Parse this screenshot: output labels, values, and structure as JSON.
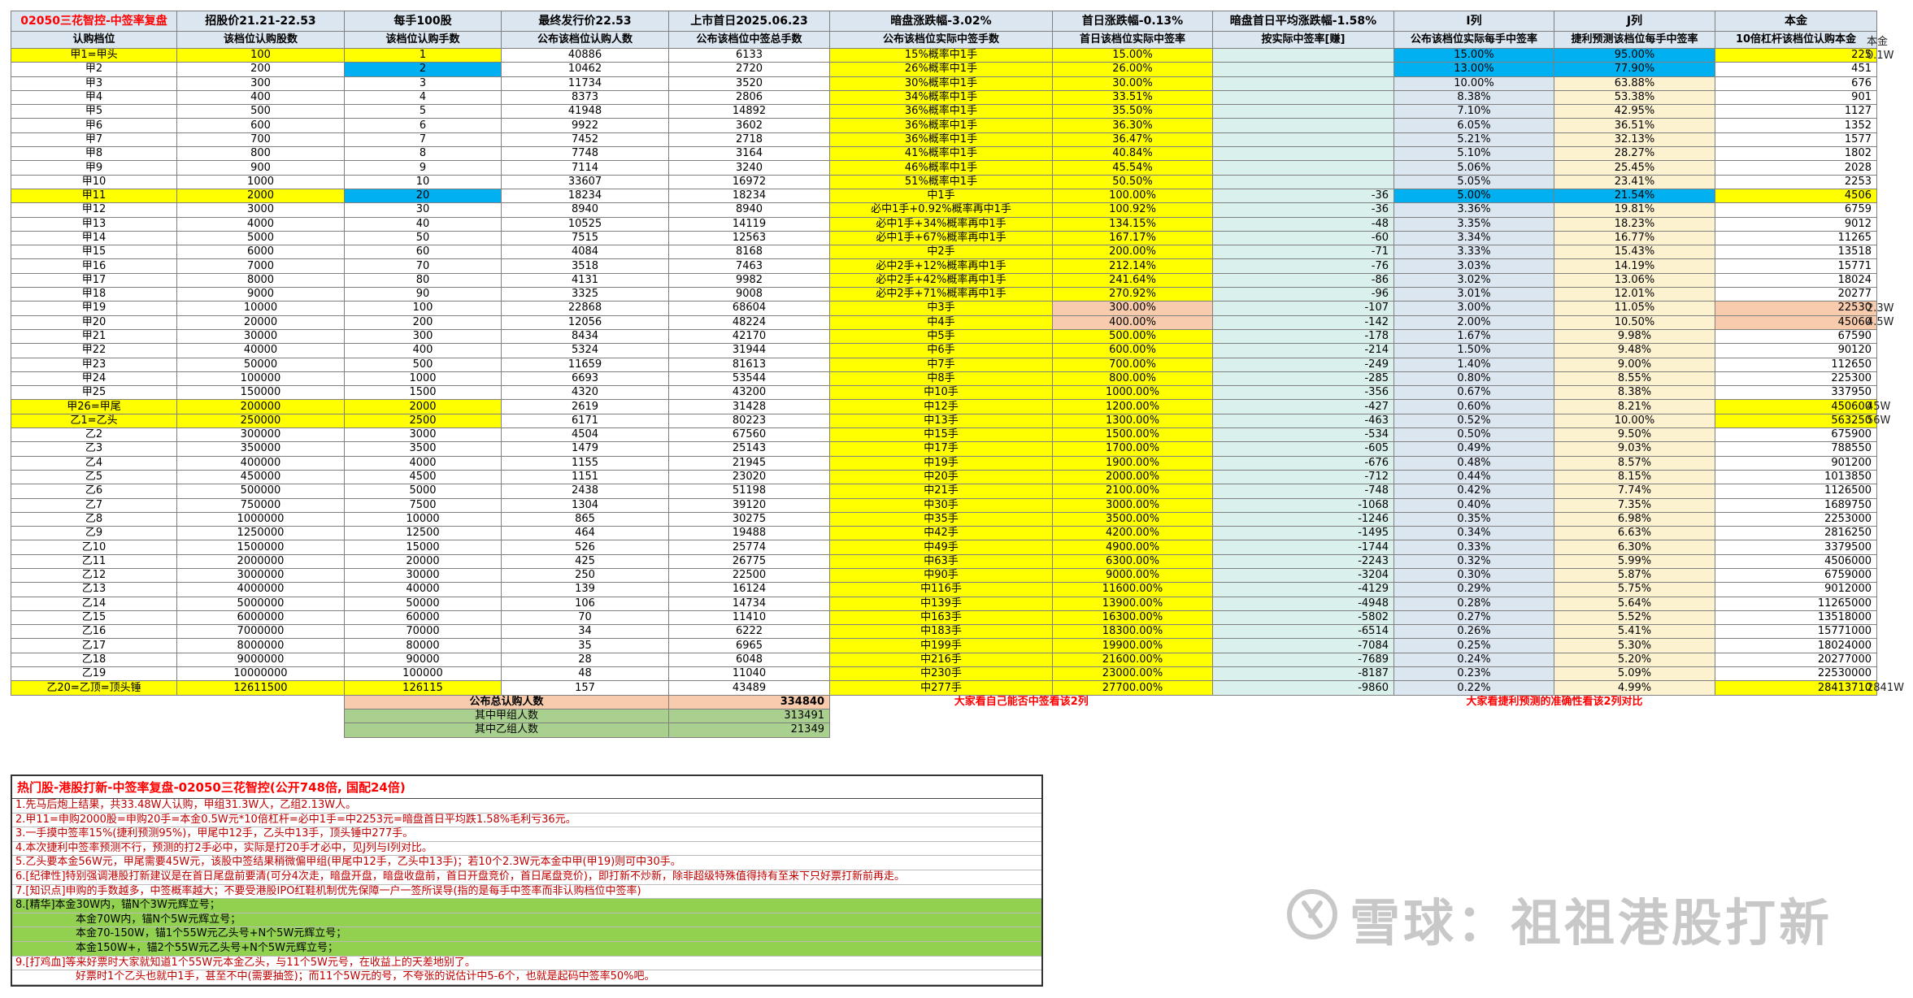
{
  "headers": {
    "title": "02050三花智控-中签率复盘",
    "price_range": "招股价21.21-22.53",
    "lot": "每手100股",
    "final_price": "最终发行价22.53",
    "listing": "上市首日2025.06.23",
    "grey": "暗盘涨跌幅-3.02%",
    "first_day": "首日涨跌幅-0.13%",
    "grey_avg": "暗盘首日平均涨跌幅-1.58%",
    "col_i": "I列",
    "col_j": "J列",
    "principal": "本金"
  },
  "subheaders": {
    "level": "认购档位",
    "shares": "该档位认购股数",
    "lots": "该档位认购手数",
    "people": "公布该档位认购人数",
    "total_lots": "公布该档位中签总手数",
    "actual": "公布该档位实际中签手数",
    "rate": "首日该档位实际中签率",
    "profit": "按实际中签率[赚]",
    "i_rate": "公布该档位实际每手中签率",
    "j_rate": "捷利预测该档位每手中签率",
    "principal": "10倍杠杆该档位认购本金"
  },
  "rows": [
    {
      "level": "甲1=甲头",
      "shares": "100",
      "lots": "1",
      "people": "40886",
      "total": "6133",
      "actual": "15%概率中1手",
      "rate": "15.00%",
      "profit": "",
      "i": "15.00%",
      "j": "95.00%",
      "principal": "225",
      "side": "0.1W",
      "hl": true
    },
    {
      "level": "甲2",
      "shares": "200",
      "lots": "2",
      "people": "10462",
      "total": "2720",
      "actual": "26%概率中1手",
      "rate": "26.00%",
      "profit": "",
      "i": "13.00%",
      "j": "77.90%",
      "principal": "451",
      "side": "",
      "bluelots": true
    },
    {
      "level": "甲3",
      "shares": "300",
      "lots": "3",
      "people": "11734",
      "total": "3520",
      "actual": "30%概率中1手",
      "rate": "30.00%",
      "profit": "",
      "i": "10.00%",
      "j": "63.88%",
      "principal": "676",
      "side": ""
    },
    {
      "level": "甲4",
      "shares": "400",
      "lots": "4",
      "people": "8373",
      "total": "2806",
      "actual": "34%概率中1手",
      "rate": "33.51%",
      "profit": "",
      "i": "8.38%",
      "j": "53.38%",
      "principal": "901",
      "side": ""
    },
    {
      "level": "甲5",
      "shares": "500",
      "lots": "5",
      "people": "41948",
      "total": "14892",
      "actual": "36%概率中1手",
      "rate": "35.50%",
      "profit": "",
      "i": "7.10%",
      "j": "42.95%",
      "principal": "1127",
      "side": ""
    },
    {
      "level": "甲6",
      "shares": "600",
      "lots": "6",
      "people": "9922",
      "total": "3602",
      "actual": "36%概率中1手",
      "rate": "36.30%",
      "profit": "",
      "i": "6.05%",
      "j": "36.51%",
      "principal": "1352",
      "side": ""
    },
    {
      "level": "甲7",
      "shares": "700",
      "lots": "7",
      "people": "7452",
      "total": "2718",
      "actual": "36%概率中1手",
      "rate": "36.47%",
      "profit": "",
      "i": "5.21%",
      "j": "32.13%",
      "principal": "1577",
      "side": ""
    },
    {
      "level": "甲8",
      "shares": "800",
      "lots": "8",
      "people": "7748",
      "total": "3164",
      "actual": "41%概率中1手",
      "rate": "40.84%",
      "profit": "",
      "i": "5.10%",
      "j": "28.27%",
      "principal": "1802",
      "side": ""
    },
    {
      "level": "甲9",
      "shares": "900",
      "lots": "9",
      "people": "7114",
      "total": "3240",
      "actual": "46%概率中1手",
      "rate": "45.54%",
      "profit": "",
      "i": "5.06%",
      "j": "25.45%",
      "principal": "2028",
      "side": ""
    },
    {
      "level": "甲10",
      "shares": "1000",
      "lots": "10",
      "people": "33607",
      "total": "16972",
      "actual": "51%概率中1手",
      "rate": "50.50%",
      "profit": "",
      "i": "5.05%",
      "j": "23.41%",
      "principal": "2253",
      "side": ""
    },
    {
      "level": "甲11",
      "shares": "2000",
      "lots": "20",
      "people": "18234",
      "total": "18234",
      "actual": "中1手",
      "rate": "100.00%",
      "profit": "-36",
      "i": "5.00%",
      "j": "21.54%",
      "principal": "4506",
      "side": "",
      "hl": true,
      "bluelots": true
    },
    {
      "level": "甲12",
      "shares": "3000",
      "lots": "30",
      "people": "8940",
      "total": "8940",
      "actual": "必中1手+0.92%概率再中1手",
      "rate": "100.92%",
      "profit": "-36",
      "i": "3.36%",
      "j": "19.81%",
      "principal": "6759",
      "side": ""
    },
    {
      "level": "甲13",
      "shares": "4000",
      "lots": "40",
      "people": "10525",
      "total": "14119",
      "actual": "必中1手+34%概率再中1手",
      "rate": "134.15%",
      "profit": "-48",
      "i": "3.35%",
      "j": "18.23%",
      "principal": "9012",
      "side": ""
    },
    {
      "level": "甲14",
      "shares": "5000",
      "lots": "50",
      "people": "7515",
      "total": "12563",
      "actual": "必中1手+67%概率再中1手",
      "rate": "167.17%",
      "profit": "-60",
      "i": "3.34%",
      "j": "16.77%",
      "principal": "11265",
      "side": ""
    },
    {
      "level": "甲15",
      "shares": "6000",
      "lots": "60",
      "people": "4084",
      "total": "8168",
      "actual": "中2手",
      "rate": "200.00%",
      "profit": "-71",
      "i": "3.33%",
      "j": "15.43%",
      "principal": "13518",
      "side": ""
    },
    {
      "level": "甲16",
      "shares": "7000",
      "lots": "70",
      "people": "3518",
      "total": "7463",
      "actual": "必中2手+12%概率再中1手",
      "rate": "212.14%",
      "profit": "-76",
      "i": "3.03%",
      "j": "14.19%",
      "principal": "15771",
      "side": ""
    },
    {
      "level": "甲17",
      "shares": "8000",
      "lots": "80",
      "people": "4131",
      "total": "9982",
      "actual": "必中2手+42%概率再中1手",
      "rate": "241.64%",
      "profit": "-86",
      "i": "3.02%",
      "j": "13.06%",
      "principal": "18024",
      "side": ""
    },
    {
      "level": "甲18",
      "shares": "9000",
      "lots": "90",
      "people": "3325",
      "total": "9008",
      "actual": "必中2手+71%概率再中1手",
      "rate": "270.92%",
      "profit": "-96",
      "i": "3.01%",
      "j": "12.01%",
      "principal": "20277",
      "side": ""
    },
    {
      "level": "甲19",
      "shares": "10000",
      "lots": "100",
      "people": "22868",
      "total": "68604",
      "actual": "中3手",
      "rate": "300.00%",
      "profit": "-107",
      "i": "3.00%",
      "j": "11.05%",
      "principal": "22530",
      "side": "2.3W",
      "peach": true
    },
    {
      "level": "甲20",
      "shares": "20000",
      "lots": "200",
      "people": "12056",
      "total": "48224",
      "actual": "中4手",
      "rate": "400.00%",
      "profit": "-142",
      "i": "2.00%",
      "j": "10.50%",
      "principal": "45060",
      "side": "4.5W",
      "peach": true
    },
    {
      "level": "甲21",
      "shares": "30000",
      "lots": "300",
      "people": "8434",
      "total": "42170",
      "actual": "中5手",
      "rate": "500.00%",
      "profit": "-178",
      "i": "1.67%",
      "j": "9.98%",
      "principal": "67590",
      "side": ""
    },
    {
      "level": "甲22",
      "shares": "40000",
      "lots": "400",
      "people": "5324",
      "total": "31944",
      "actual": "中6手",
      "rate": "600.00%",
      "profit": "-214",
      "i": "1.50%",
      "j": "9.48%",
      "principal": "90120",
      "side": ""
    },
    {
      "level": "甲23",
      "shares": "50000",
      "lots": "500",
      "people": "11659",
      "total": "81613",
      "actual": "中7手",
      "rate": "700.00%",
      "profit": "-249",
      "i": "1.40%",
      "j": "9.00%",
      "principal": "112650",
      "side": ""
    },
    {
      "level": "甲24",
      "shares": "100000",
      "lots": "1000",
      "people": "6693",
      "total": "53544",
      "actual": "中8手",
      "rate": "800.00%",
      "profit": "-285",
      "i": "0.80%",
      "j": "8.55%",
      "principal": "225300",
      "side": ""
    },
    {
      "level": "甲25",
      "shares": "150000",
      "lots": "1500",
      "people": "4320",
      "total": "43200",
      "actual": "中10手",
      "rate": "1000.00%",
      "profit": "-356",
      "i": "0.67%",
      "j": "8.38%",
      "principal": "337950",
      "side": ""
    },
    {
      "level": "甲26=甲尾",
      "shares": "200000",
      "lots": "2000",
      "people": "2619",
      "total": "31428",
      "actual": "中12手",
      "rate": "1200.00%",
      "profit": "-427",
      "i": "0.60%",
      "j": "8.21%",
      "principal": "450600",
      "side": "45W",
      "hl": true
    },
    {
      "level": "乙1=乙头",
      "shares": "250000",
      "lots": "2500",
      "people": "6171",
      "total": "80223",
      "actual": "中13手",
      "rate": "1300.00%",
      "profit": "-463",
      "i": "0.52%",
      "j": "10.00%",
      "principal": "563250",
      "side": "56W",
      "hl": true
    },
    {
      "level": "乙2",
      "shares": "300000",
      "lots": "3000",
      "people": "4504",
      "total": "67560",
      "actual": "中15手",
      "rate": "1500.00%",
      "profit": "-534",
      "i": "0.50%",
      "j": "9.50%",
      "principal": "675900",
      "side": ""
    },
    {
      "level": "乙3",
      "shares": "350000",
      "lots": "3500",
      "people": "1479",
      "total": "25143",
      "actual": "中17手",
      "rate": "1700.00%",
      "profit": "-605",
      "i": "0.49%",
      "j": "9.03%",
      "principal": "788550",
      "side": ""
    },
    {
      "level": "乙4",
      "shares": "400000",
      "lots": "4000",
      "people": "1155",
      "total": "21945",
      "actual": "中19手",
      "rate": "1900.00%",
      "profit": "-676",
      "i": "0.48%",
      "j": "8.57%",
      "principal": "901200",
      "side": ""
    },
    {
      "level": "乙5",
      "shares": "450000",
      "lots": "4500",
      "people": "1151",
      "total": "23020",
      "actual": "中20手",
      "rate": "2000.00%",
      "profit": "-712",
      "i": "0.44%",
      "j": "8.15%",
      "principal": "1013850",
      "side": ""
    },
    {
      "level": "乙6",
      "shares": "500000",
      "lots": "5000",
      "people": "2438",
      "total": "51198",
      "actual": "中21手",
      "rate": "2100.00%",
      "profit": "-748",
      "i": "0.42%",
      "j": "7.74%",
      "principal": "1126500",
      "side": ""
    },
    {
      "level": "乙7",
      "shares": "750000",
      "lots": "7500",
      "people": "1304",
      "total": "39120",
      "actual": "中30手",
      "rate": "3000.00%",
      "profit": "-1068",
      "i": "0.40%",
      "j": "7.35%",
      "principal": "1689750",
      "side": ""
    },
    {
      "level": "乙8",
      "shares": "1000000",
      "lots": "10000",
      "people": "865",
      "total": "30275",
      "actual": "中35手",
      "rate": "3500.00%",
      "profit": "-1246",
      "i": "0.35%",
      "j": "6.98%",
      "principal": "2253000",
      "side": ""
    },
    {
      "level": "乙9",
      "shares": "1250000",
      "lots": "12500",
      "people": "464",
      "total": "19488",
      "actual": "中42手",
      "rate": "4200.00%",
      "profit": "-1495",
      "i": "0.34%",
      "j": "6.63%",
      "principal": "2816250",
      "side": ""
    },
    {
      "level": "乙10",
      "shares": "1500000",
      "lots": "15000",
      "people": "526",
      "total": "25774",
      "actual": "中49手",
      "rate": "4900.00%",
      "profit": "-1744",
      "i": "0.33%",
      "j": "6.30%",
      "principal": "3379500",
      "side": ""
    },
    {
      "level": "乙11",
      "shares": "2000000",
      "lots": "20000",
      "people": "425",
      "total": "26775",
      "actual": "中63手",
      "rate": "6300.00%",
      "profit": "-2243",
      "i": "0.32%",
      "j": "5.99%",
      "principal": "4506000",
      "side": ""
    },
    {
      "level": "乙12",
      "shares": "3000000",
      "lots": "30000",
      "people": "250",
      "total": "22500",
      "actual": "中90手",
      "rate": "9000.00%",
      "profit": "-3204",
      "i": "0.30%",
      "j": "5.87%",
      "principal": "6759000",
      "side": ""
    },
    {
      "level": "乙13",
      "shares": "4000000",
      "lots": "40000",
      "people": "139",
      "total": "16124",
      "actual": "中116手",
      "rate": "11600.00%",
      "profit": "-4129",
      "i": "0.29%",
      "j": "5.75%",
      "principal": "9012000",
      "side": ""
    },
    {
      "level": "乙14",
      "shares": "5000000",
      "lots": "50000",
      "people": "106",
      "total": "14734",
      "actual": "中139手",
      "rate": "13900.00%",
      "profit": "-4948",
      "i": "0.28%",
      "j": "5.64%",
      "principal": "11265000",
      "side": ""
    },
    {
      "level": "乙15",
      "shares": "6000000",
      "lots": "60000",
      "people": "70",
      "total": "11410",
      "actual": "中163手",
      "rate": "16300.00%",
      "profit": "-5802",
      "i": "0.27%",
      "j": "5.52%",
      "principal": "13518000",
      "side": ""
    },
    {
      "level": "乙16",
      "shares": "7000000",
      "lots": "70000",
      "people": "34",
      "total": "6222",
      "actual": "中183手",
      "rate": "18300.00%",
      "profit": "-6514",
      "i": "0.26%",
      "j": "5.41%",
      "principal": "15771000",
      "side": ""
    },
    {
      "level": "乙17",
      "shares": "8000000",
      "lots": "80000",
      "people": "35",
      "total": "6965",
      "actual": "中199手",
      "rate": "19900.00%",
      "profit": "-7084",
      "i": "0.25%",
      "j": "5.30%",
      "principal": "18024000",
      "side": ""
    },
    {
      "level": "乙18",
      "shares": "9000000",
      "lots": "90000",
      "people": "28",
      "total": "6048",
      "actual": "中216手",
      "rate": "21600.00%",
      "profit": "-7689",
      "i": "0.24%",
      "j": "5.20%",
      "principal": "20277000",
      "side": ""
    },
    {
      "level": "乙19",
      "shares": "10000000",
      "lots": "100000",
      "people": "48",
      "total": "11040",
      "actual": "中230手",
      "rate": "23000.00%",
      "profit": "-8187",
      "i": "0.23%",
      "j": "5.09%",
      "principal": "22530000",
      "side": ""
    },
    {
      "level": "乙20=乙顶=顶头锤",
      "shares": "12611500",
      "lots": "126115",
      "people": "157",
      "total": "43489",
      "actual": "中277手",
      "rate": "27700.00%",
      "profit": "-9860",
      "i": "0.22%",
      "j": "4.99%",
      "principal": "28413710",
      "side": "2841W",
      "hl": true
    }
  ],
  "summary": [
    {
      "label": "公布总认购人数",
      "value": "334840"
    },
    {
      "label": "其中甲组人数",
      "value": "313491"
    },
    {
      "label": "其中乙组人数",
      "value": "21349"
    }
  ],
  "footers": {
    "left": "大家看自己能否中签看该2列",
    "right": "大家看捷利预测的准确性看该2列对比"
  },
  "notes": {
    "title": "热门股-港股打新-中签率复盘-02050三花智控(公开748倍, 国配24倍)",
    "lines": [
      {
        "t": "1.先马后炮上结果，共33.48W人认购，甲组31.3W人，乙组2.13W人。"
      },
      {
        "t": "2.甲11=申购2000股=申购20手=本金0.5W元*10倍杠杆=必中1手=中2253元=暗盘首日平均跌1.58%毛利亏36元。"
      },
      {
        "t": "3.一手摸中签率15%(捷利预测95%)，甲尾中12手，乙头中13手，顶头锤中277手。"
      },
      {
        "t": "4.本次捷利中签率预测不行，预测的打2手必中，实际是打20手才必中，见J列与I列对比。"
      },
      {
        "t": "5.乙头要本金56W元，甲尾需要45W元，该股中签结果稍微偏甲组(甲尾中12手，乙头中13手)；若10个2.3W元本金中甲(甲19)则可中30手。"
      },
      {
        "t": "6.[纪律性]特别强调港股打新建议是在首日尾盘前要清(可分4次走，暗盘开盘，暗盘收盘前，首日开盘竞价，首日尾盘竞价)，即打新不炒新，除非超级特殊值得持有至来下只好票打新前再走。"
      },
      {
        "t": "7.[知识点]申购的手数越多，中签概率越大；不要受港股IPO红鞋机制优先保障一户一签所误导(指的是每手中签率而非认购档位中签率)"
      },
      {
        "t": "8.[精华]本金30W内，锚N个3W元辉立号；",
        "green": true
      },
      {
        "t": "本金70W内，锚N个5W元辉立号；",
        "green": true,
        "in": true
      },
      {
        "t": "本金70-150W，锚1个55W元乙头号+N个5W元辉立号；",
        "green": true,
        "in": true
      },
      {
        "t": "本金150W+，锚2个55W元乙头号+N个5W元辉立号；",
        "green": true,
        "in": true
      },
      {
        "t": "9.[打鸡血]等来好票时大家就知道1个55W元本金乙头，与11个5W元号，在收益上的天差地别了。"
      },
      {
        "t": "好票时1个乙头也就中1手，甚至不中(需要抽签)；而11个5W元的号，不夸张的说估计中5-6个，也就是起码中签率50%吧。",
        "in": true
      }
    ]
  },
  "side_top": "本金",
  "watermark": "雪球：祖祖港股打新"
}
